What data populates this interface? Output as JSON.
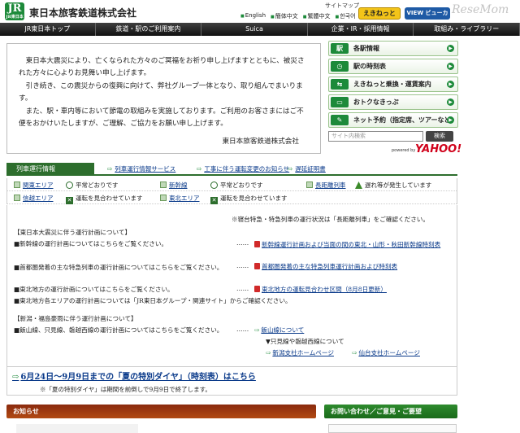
{
  "header": {
    "logo_text": "JR",
    "logo_sub": "JR東日本",
    "company": "東日本旅客鉄道株式会社",
    "sitemap": "サイトマップ",
    "languages": [
      "English",
      "簡体中文",
      "繁體中文",
      "한국어"
    ],
    "eki_btn": "えきねっと",
    "view_btn": "VIEW ビューカード",
    "watermark": "ReseMom"
  },
  "nav": {
    "items": [
      "JR東日本トップ",
      "鉄道・駅のご利用案内",
      "Suica",
      "企業・IR・採用情報",
      "取組み・ライブラリー"
    ]
  },
  "message": {
    "p1": "東日本大震災により、亡くなられた方々のご冥福をお祈り申し上げますとともに、被災された方々に心よりお見舞い申し上げます。",
    "p2": "引き続き、この震災からの復興に向けて、弊社グループ一体となり、取り組んでまいります。",
    "p3": "また、駅・車内等において節電の取組みを実施しております。ご利用のお客さまにはご不便をおかけいたしますが、ご理解、ご協力をお願い申し上げます。",
    "sign": "東日本旅客鉄道株式会社"
  },
  "right_menu": [
    {
      "label": "各駅情報",
      "icon": "station-icon"
    },
    {
      "label": "駅の時刻表",
      "icon": "clock-icon"
    },
    {
      "label": "えきねっと乗換・運賃案内",
      "icon": "route-icon"
    },
    {
      "label": "おトクなきっぷ",
      "icon": "ticket-icon"
    },
    {
      "label": "ネット予約（指定席、ツアーなど）",
      "icon": "reserve-icon"
    }
  ],
  "search": {
    "placeholder": "サイト内検索",
    "button": "検索",
    "powered": "powered by",
    "provider": "YAHOO!"
  },
  "train_info": {
    "tab": "列車運行情報",
    "links": [
      "列車運行情報サービス",
      "工事に伴う運転変更のお知らせ",
      "遅延証明書"
    ],
    "rows": [
      {
        "area": "関東エリア",
        "state": "平常どおりです",
        "area2": "新幹線",
        "state2": "平常どおりです",
        "area3": "長距離列車",
        "state3": "遅れ等が発生しています"
      },
      {
        "area": "信越エリア",
        "state": "運転を見合わせています",
        "area2": "東北エリア",
        "state2": "運転を見合わせています"
      }
    ]
  },
  "operations": {
    "note": "※寝台特急・特急列車の運行状況は「長距離列車」をご確認ください。",
    "sec1_title": "【東日本大震災に伴う運行計画について】",
    "l1": "■新幹線の運行計画についてはこちらをご覧ください。",
    "l1_link": "新幹線運行計画および当面の間の東北・山形・秋田新幹線時刻表",
    "l2": "■首都圏発着の主な特急列車の運行計画についてはこちらをご覧ください。",
    "l2_link": "首都圏発着の主な特急列車運行計画および時刻表",
    "l3": "■東北地方の運行計画についてはこちらをご覧ください。",
    "l3_link": "東北地方の運転見合わせ区間（8月8日更新）",
    "l4": "■東北地方各エリアの運行計画については「JR東日本グループ・関連サイト」からご確認ください。",
    "sec2_title": "【新潟・福島豪雨に伴う運行計画について】",
    "l5": "■飯山線、只見線、磐越西線の運行計画についてはこちらをご覧ください。",
    "l5_link": "飯山線について",
    "l6": "▼只見線や磐越西線について",
    "l6_link_a": "新潟支社ホームページ",
    "l6_link_b": "仙台支社ホームページ",
    "dots": "……"
  },
  "summer": {
    "title": "6月24日～9月9日までの「夏の特別ダイヤ」（時刻表）はこちら",
    "note": "※「夏の特別ダイヤ」は期間を前倒しで9月9日で終了します。"
  },
  "news": {
    "title": "お知らせ"
  },
  "contact": {
    "title": "お問い合わせ／ご意見・ご要望"
  }
}
